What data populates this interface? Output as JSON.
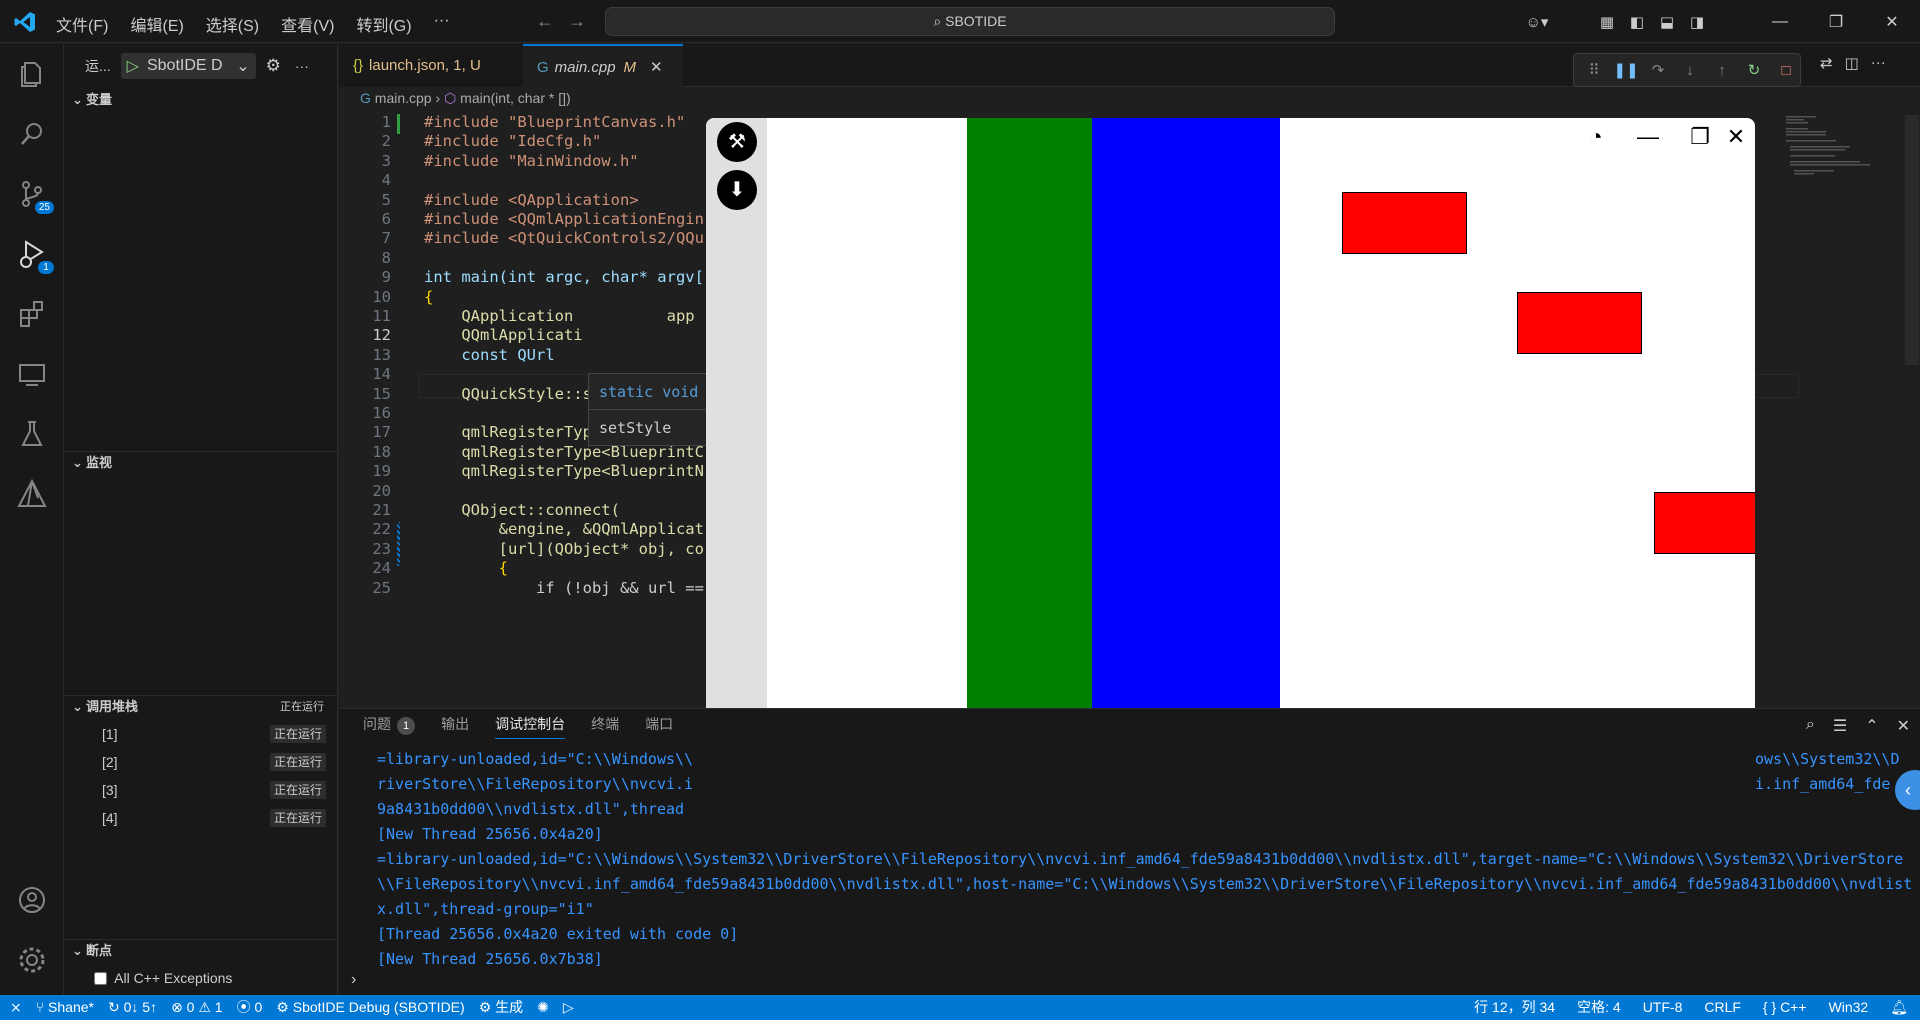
{
  "titlebar": {
    "menu": [
      "文件(F)",
      "编辑(E)",
      "选择(S)",
      "查看(V)",
      "转到(G)",
      "···"
    ],
    "search": "SBOTIDE"
  },
  "activity": {
    "scm_badge": "25",
    "debug_badge": "1"
  },
  "sidebar": {
    "run_label": "运...",
    "debug_config": "SbotIDE D",
    "variables": "变量",
    "watch": "监视",
    "callstack": "调用堆栈",
    "callstack_status": "正在运行",
    "stack": [
      {
        "label": "[1]",
        "status": "正在运行"
      },
      {
        "label": "[2]",
        "status": "正在运行"
      },
      {
        "label": "[3]",
        "status": "正在运行"
      },
      {
        "label": "[4]",
        "status": "正在运行"
      }
    ],
    "breakpoints": "断点",
    "all_exceptions": "All C++ Exceptions"
  },
  "tabs": [
    {
      "label": "launch.json",
      "status": "1, U"
    },
    {
      "label": "main.cpp",
      "status": "M"
    }
  ],
  "breadcrumb": {
    "file": "main.cpp",
    "symbol": "main(int, char * [])"
  },
  "code": {
    "line_numbers": [
      "1",
      "2",
      "3",
      "4",
      "5",
      "6",
      "7",
      "8",
      "9",
      "10",
      "11",
      "12",
      "13",
      "14",
      "15",
      "16",
      "17",
      "18",
      "19",
      "20",
      "21",
      "22",
      "23",
      "24",
      "25"
    ],
    "lines": [
      "#include \"BlueprintCanvas.h\"",
      "#include \"IdeCfg.h\"",
      "#include \"MainWindow.h\"",
      "",
      "#include <QApplication>",
      "#include <QQmlApplicationEngin",
      "#include <QtQuickControls2/QQu",
      "",
      "int main(int argc, char* argv[",
      "{",
      "    QApplication          app",
      "    QQmlApplicati",
      "    const QUrl",
      "",
      "    QQuickStyle::setStyle(\"Bas",
      "",
      "    qmlRegisterType<MainWindow",
      "    qmlRegisterType<BlueprintC",
      "    qmlRegisterType<BlueprintN",
      "",
      "    QObject::connect(",
      "        &engine, &QQmlApplicat",
      "        [url](QObject* obj, co",
      "        {",
      "            if (!obj && url =="
    ]
  },
  "suggest": {
    "signature": "static void",
    "item": "setStyle"
  },
  "panel": {
    "tabs": [
      "问题",
      "输出",
      "调试控制台",
      "终端",
      "端口"
    ],
    "problem_count": "1",
    "console": [
      "=library-unloaded,id=\"C:\\\\Windows\\\\",
      "riverStore\\\\FileRepository\\\\nvcvi.i",
      "9a8431b0dd00\\\\nvdlistx.dll\",thread",
      "[New Thread 25656.0x4a20]",
      "=library-unloaded,id=\"C:\\\\Windows\\\\System32\\\\DriverStore\\\\FileRepository\\\\nvcvi.inf_amd64_fde59a8431b0dd00\\\\nvdlistx.dll\",target-name=\"C:\\\\Windows\\\\System32\\\\DriverStore\\\\FileRepository\\\\nvcvi.inf_amd64_fde59a8431b0dd00\\\\nvdlistx.dll\",host-name=\"C:\\\\Windows\\\\System32\\\\DriverStore\\\\FileRepository\\\\nvcvi.inf_amd64_fde59a8431b0dd00\\\\nvdlistx.dll\",thread-group=\"i1\"",
      "[Thread 25656.0x4a20 exited with code 0]",
      "[New Thread 25656.0x7b38]"
    ],
    "right_fragments": [
      "ows\\\\System32\\\\D",
      "i.inf_amd64_fde"
    ]
  },
  "statusbar": {
    "branch": "Shane*",
    "sync": "0↓ 5↑",
    "errors": "⊗ 0 ⚠ 1",
    "ports": "0",
    "debug": "SbotIDE Debug (SBOTIDE)",
    "build": "生成",
    "position": "行 12，列 34",
    "spaces": "空格: 4",
    "encoding": "UTF-8",
    "eol": "CRLF",
    "lang": "C++",
    "platform": "Win32"
  },
  "colors": {
    "accent": "#0078d4",
    "green": "#008000",
    "blue": "#0000ff",
    "red": "#ff0000"
  }
}
